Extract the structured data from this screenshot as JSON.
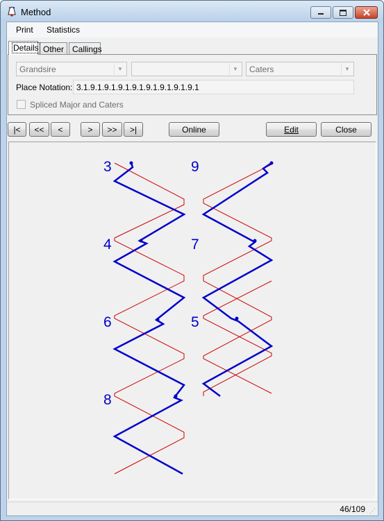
{
  "window": {
    "title": "Method"
  },
  "menu": [
    "Print",
    "Statistics"
  ],
  "tabs": [
    "Details",
    "Other",
    "Callings"
  ],
  "details": {
    "method_combo": "Grandsire",
    "blank_combo": "",
    "stage_combo": "Caters",
    "place_notation_label": "Place Notation:",
    "place_notation": "3.1.9.1.9.1.9.1.9.1.9.1.9.1.9.1.9.1",
    "spliced_label": "Spliced Major and Caters",
    "spliced_checked": false
  },
  "nav": {
    "first": "|<",
    "prev_page": "<<",
    "prev": "<",
    "next": ">",
    "next_page": ">>",
    "last": ">|",
    "online": "Online",
    "edit": "Edit",
    "close": "Close"
  },
  "diagram": {
    "left_column_numbers": [
      "3",
      "4",
      "6",
      "8"
    ],
    "right_column_numbers": [
      "9",
      "7",
      "5"
    ],
    "blue_color": "#0000cc",
    "red_color": "#cc0000"
  },
  "status": {
    "page": "46/109"
  }
}
